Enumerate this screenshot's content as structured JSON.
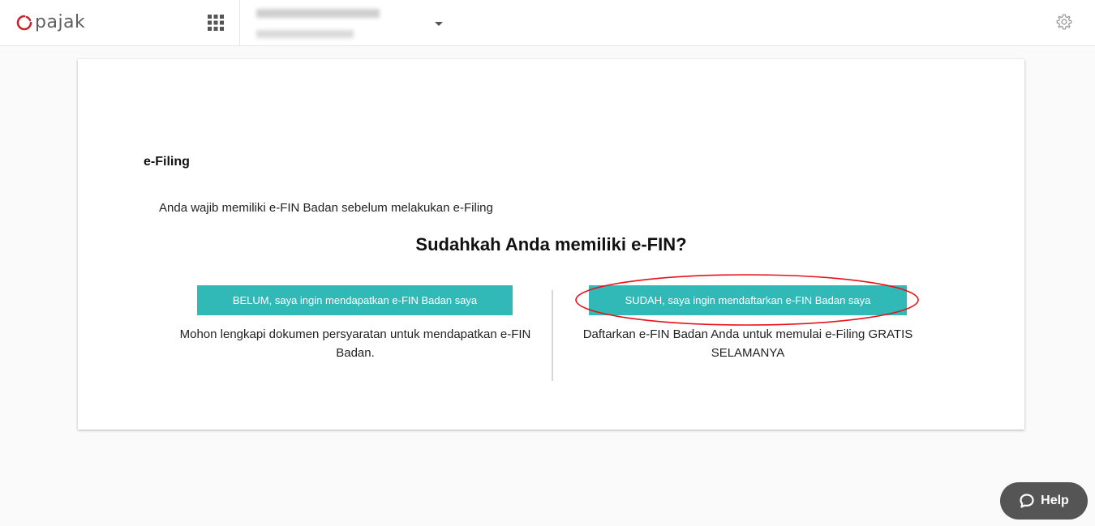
{
  "header": {
    "logo_text": "pajak",
    "logo_color": "#c9252c",
    "apps_icon": "grid-apps-icon",
    "settings_icon": "gear-icon",
    "account_menu_icon": "caret-down-icon"
  },
  "main": {
    "section_title": "e-Filing",
    "notice": "Anda wajib memiliki e-FIN Badan sebelum melakukan e-Filing",
    "question": "Sudahkah Anda memiliki e-FIN?",
    "left_option": {
      "button_label": "BELUM, saya ingin mendapatkan e-FIN Badan saya",
      "description": "Mohon lengkapi dokumen persyaratan untuk mendapatkan e-FIN Badan."
    },
    "right_option": {
      "button_label": "SUDAH, saya ingin mendaftarkan e-FIN Badan saya",
      "description": "Daftarkan e-FIN Badan Anda untuk memulai e-Filing GRATIS SELAMANYA"
    },
    "button_color": "#31b9b8",
    "highlight_color": "#e8121a"
  },
  "help": {
    "label": "Help",
    "icon": "chat-bubble-icon",
    "background": "#555555"
  }
}
